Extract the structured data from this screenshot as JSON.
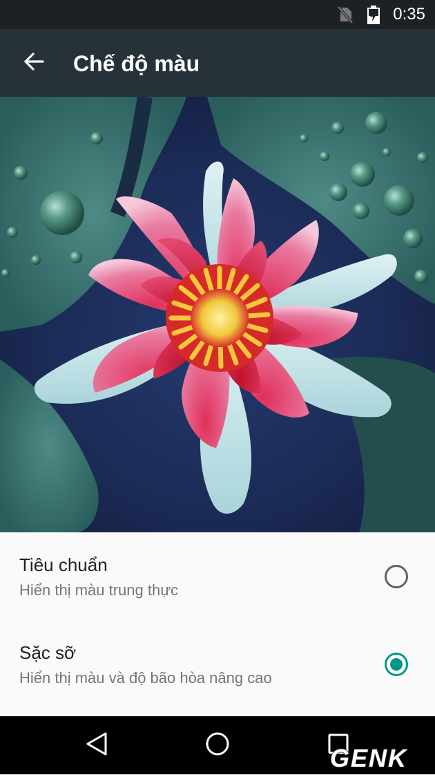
{
  "status_bar": {
    "time": "0:35",
    "icons": [
      "no-sim-icon",
      "battery-charging-icon"
    ]
  },
  "app_bar": {
    "title": "Chế độ màu",
    "back_icon": "arrow-back-icon"
  },
  "preview": {
    "subject": "lotus-flower-image"
  },
  "options": [
    {
      "title": "Tiêu chuẩn",
      "subtitle": "Hiển thị màu trung thực",
      "selected": false
    },
    {
      "title": "Sặc sỡ",
      "subtitle": "Hiển thị màu và độ bão hòa nâng cao",
      "selected": true
    }
  ],
  "nav_bar": {
    "buttons": [
      "back-triangle-icon",
      "home-circle-icon",
      "recents-square-icon"
    ]
  },
  "watermark": {
    "text": "GENK"
  },
  "colors": {
    "status_bar_bg": "#1e2124",
    "app_bar_bg": "#263238",
    "accent": "#009688",
    "radio_off": "#616161",
    "title_text": "#212121",
    "subtitle_text": "#757575",
    "nav_bar_bg": "#000000"
  }
}
